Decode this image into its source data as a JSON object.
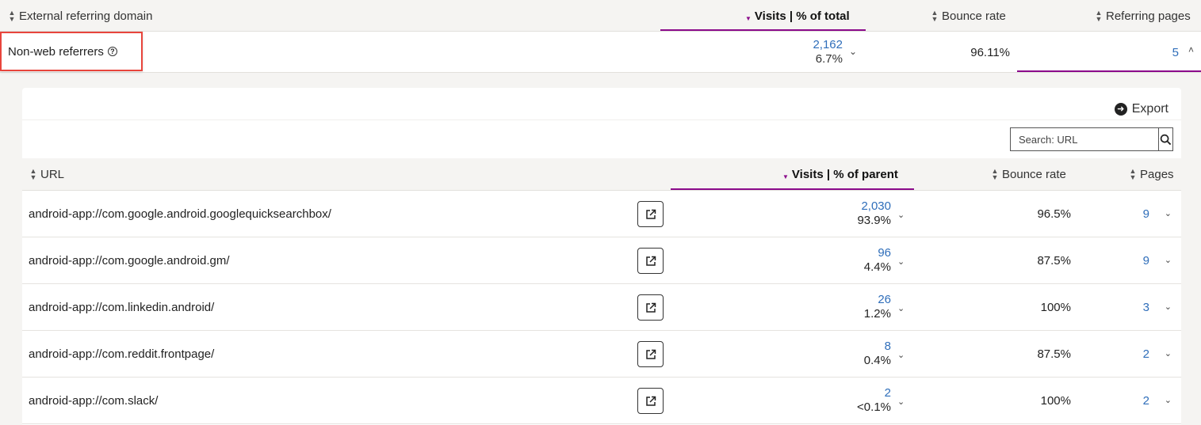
{
  "outer": {
    "headers": {
      "domain": "External referring domain",
      "visits": "Visits | % of total",
      "bounce": "Bounce rate",
      "pages": "Referring pages"
    },
    "row": {
      "domain": "Non-web referrers",
      "visits": "2,162",
      "percent": "6.7%",
      "bounce": "96.11%",
      "pages": "5"
    }
  },
  "panel": {
    "export_label": "Export",
    "search_placeholder": "Search: URL",
    "headers": {
      "url": "URL",
      "visits": "Visits | % of parent",
      "bounce": "Bounce rate",
      "pages": "Pages"
    },
    "rows": [
      {
        "url": "android-app://com.google.android.googlequicksearchbox/",
        "visits": "2,030",
        "percent": "93.9%",
        "bounce": "96.5%",
        "pages": "9"
      },
      {
        "url": "android-app://com.google.android.gm/",
        "visits": "96",
        "percent": "4.4%",
        "bounce": "87.5%",
        "pages": "9"
      },
      {
        "url": "android-app://com.linkedin.android/",
        "visits": "26",
        "percent": "1.2%",
        "bounce": "100%",
        "pages": "3"
      },
      {
        "url": "android-app://com.reddit.frontpage/",
        "visits": "8",
        "percent": "0.4%",
        "bounce": "87.5%",
        "pages": "2"
      },
      {
        "url": "android-app://com.slack/",
        "visits": "2",
        "percent": "<0.1%",
        "bounce": "100%",
        "pages": "2"
      }
    ]
  },
  "colors": {
    "accent": "#8b0a8b",
    "link": "#2f6eba",
    "highlight": "#e8453c"
  }
}
